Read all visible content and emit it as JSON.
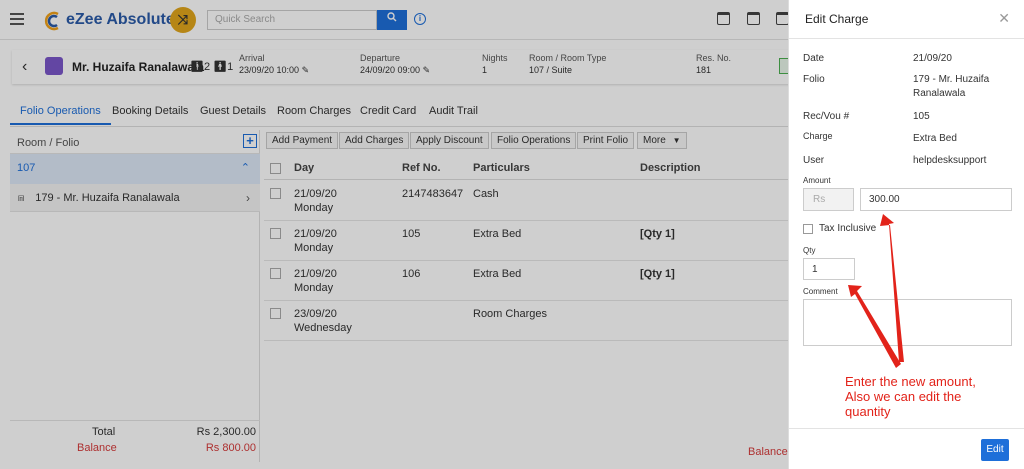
{
  "topbar": {
    "app_name": "eZee Absolute",
    "search_placeholder": "Quick Search"
  },
  "guest": {
    "name": "Mr. Huzaifa Ranalawala",
    "adults": "2",
    "children": "1",
    "arrival_label": "Arrival",
    "arrival_value": "23/09/20 10:00",
    "departure_label": "Departure",
    "departure_value": "24/09/20 09:00",
    "nights_label": "Nights",
    "nights_value": "1",
    "room_label": "Room / Room Type",
    "room_value": "107 / Suite",
    "resno_label": "Res. No.",
    "resno_value": "181"
  },
  "tabs": [
    "Folio Operations",
    "Booking Details",
    "Guest Details",
    "Room Charges",
    "Credit Card",
    "Audit Trail"
  ],
  "folio_panel": {
    "header": "Room / Folio",
    "room": "107",
    "folio": "179 - Mr. Huzaifa Ranalawala",
    "total_label": "Total",
    "total_value": "Rs 2,300.00",
    "balance_label": "Balance",
    "balance_value": "Rs 800.00"
  },
  "actions": [
    "Add Payment",
    "Add Charges",
    "Apply Discount",
    "Folio Operations",
    "Print Folio",
    "More"
  ],
  "table": {
    "headers": [
      "Day",
      "Ref No.",
      "Particulars",
      "Description"
    ],
    "rows": [
      {
        "date": "21/09/20",
        "day": "Monday",
        "ref": "2147483647",
        "particulars": "Cash",
        "description": ""
      },
      {
        "date": "21/09/20",
        "day": "Monday",
        "ref": "105",
        "particulars": "Extra Bed",
        "description": "[Qty 1]"
      },
      {
        "date": "21/09/20",
        "day": "Monday",
        "ref": "106",
        "particulars": "Extra Bed",
        "description": "[Qty 1]"
      },
      {
        "date": "23/09/20",
        "day": "Wednesday",
        "ref": "",
        "particulars": "Room Charges",
        "description": ""
      }
    ],
    "footer_balance": "Balance"
  },
  "drawer": {
    "title": "Edit Charge",
    "date_label": "Date",
    "date_value": "21/09/20",
    "folio_label": "Folio",
    "folio_value_1": "179 - Mr. Huzaifa",
    "folio_value_2": "Ranalawala",
    "recvou_label": "Rec/Vou #",
    "recvou_value": "105",
    "charge_label": "Charge",
    "charge_value": "Extra Bed",
    "user_label": "User",
    "user_value": "helpdesksupport",
    "amount_label": "Amount",
    "currency": "Rs",
    "amount_value": "300.00",
    "tax_label": "Tax Inclusive",
    "tax_checked": false,
    "qty_label": "Qty",
    "qty_value": "1",
    "comment_label": "Comment",
    "edit_label": "Edit"
  },
  "annotation": {
    "line1": "Enter the new amount,",
    "line2": "Also we can edit the",
    "line3": "quantity",
    "color": "#e2231a"
  },
  "colors": {
    "accent": "#1e6fd9",
    "negative": "#d63b3b",
    "brand_badge": "#e0a61c"
  }
}
